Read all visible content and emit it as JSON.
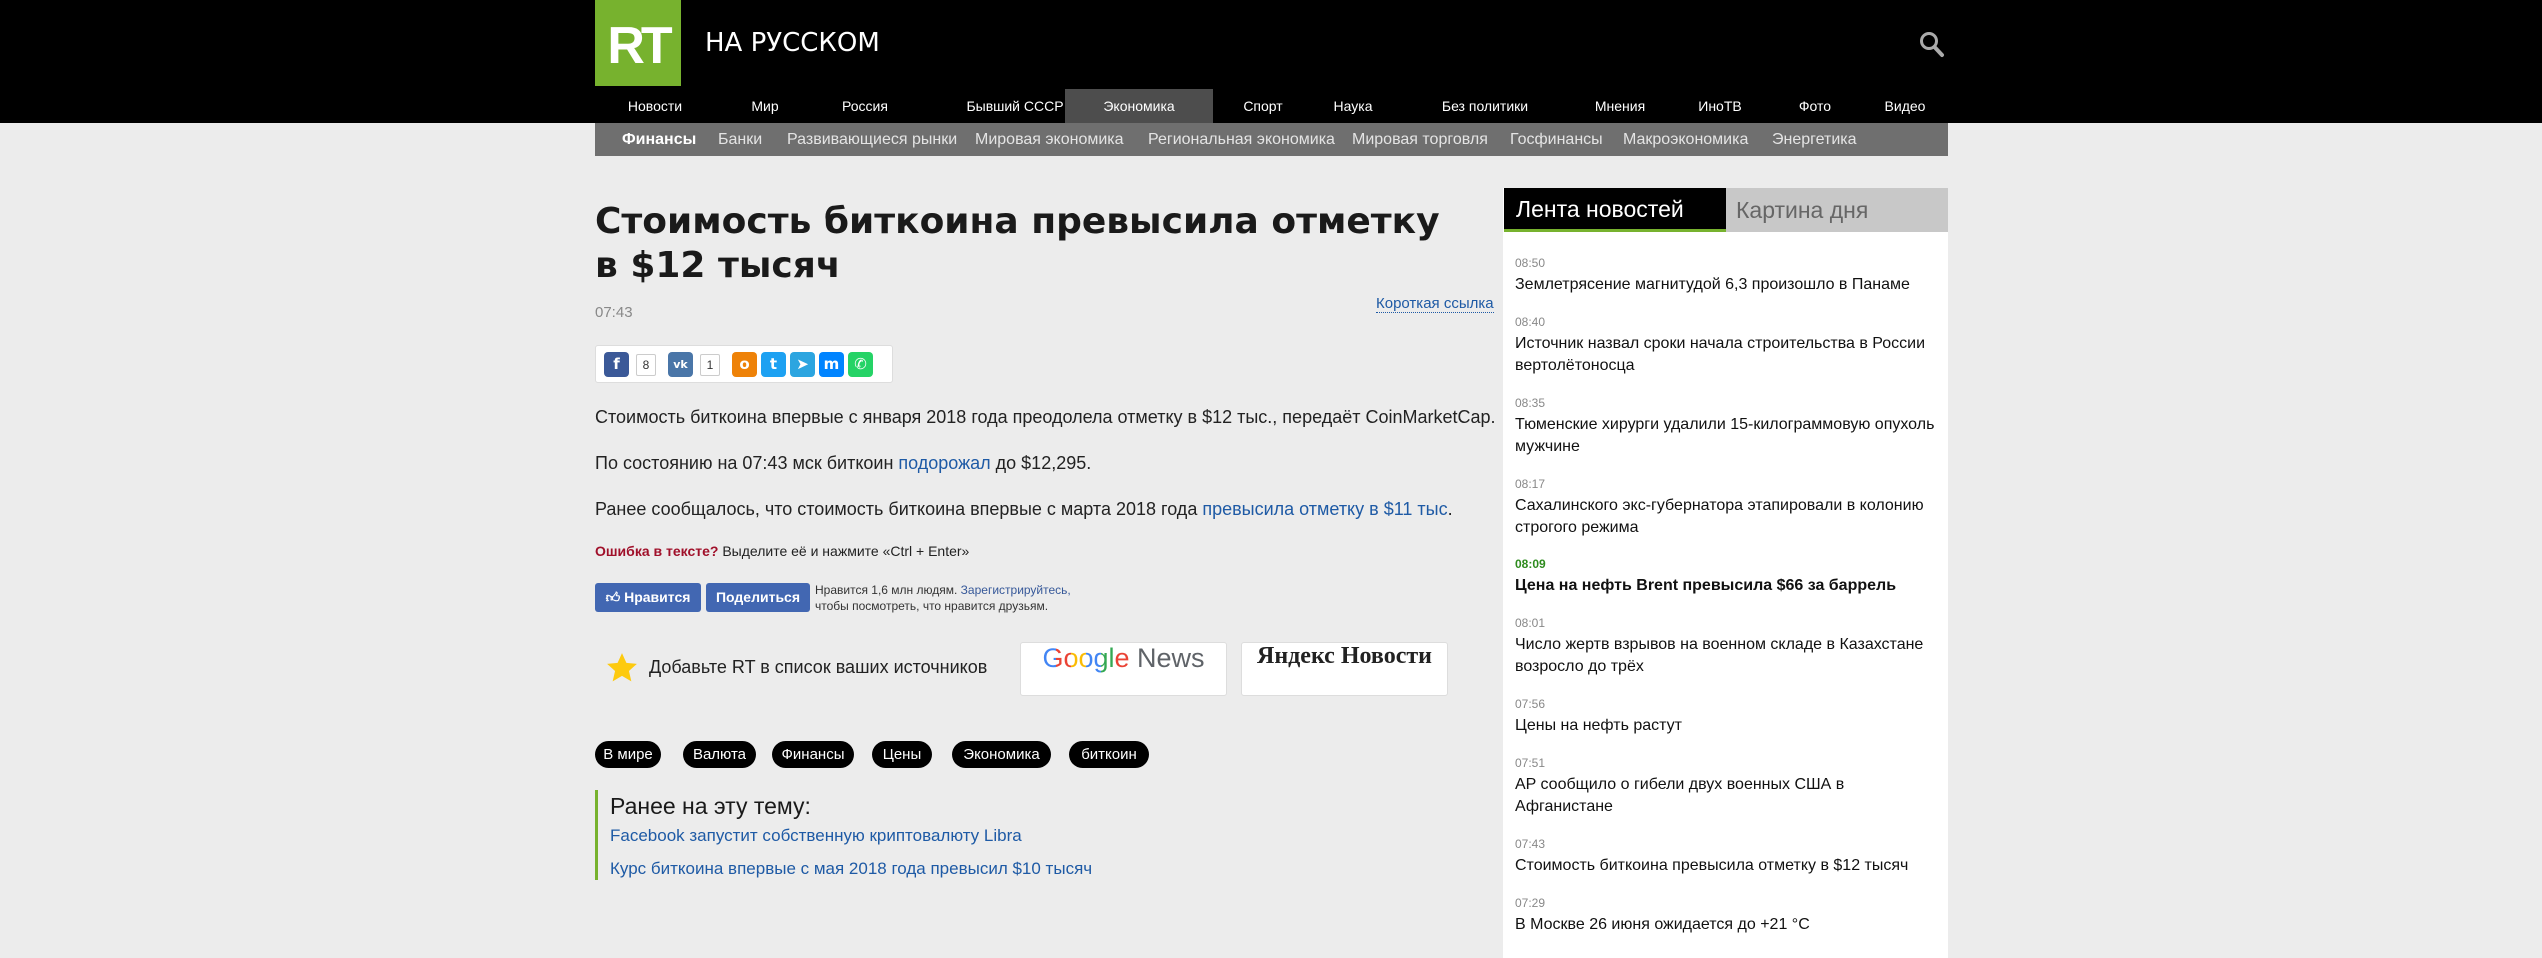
{
  "header": {
    "logo": "RT",
    "site_name": "НА РУССКОМ"
  },
  "nav": [
    "Новости",
    "Мир",
    "Россия",
    "Бывший СССР",
    "Экономика",
    "Спорт",
    "Наука",
    "Без политики",
    "Мнения",
    "ИноТВ",
    "Фото",
    "Видео"
  ],
  "subnav": [
    "Финансы",
    "Банки",
    "Развивающиеся рынки",
    "Мировая экономика",
    "Региональная экономика",
    "Мировая торговля",
    "Госфинансы",
    "Макроэкономика",
    "Энергетика"
  ],
  "article": {
    "title": "Стоимость биткоина превысила отметку в $12 тысяч",
    "time": "07:43",
    "short_link": "Короткая ссылка",
    "share": {
      "fb_count": "8",
      "vk_count": "1"
    },
    "p1": "Стоимость биткоина впервые с января 2018 года преодолела отметку в $12 тыс., передаёт CoinMarketCap.",
    "p2_before": "По состоянию на 07:43 мск биткоин ",
    "p2_link": "подорожал",
    "p2_after": " до $12,295.",
    "p3_before": "Ранее сообщалось, что стоимость биткоина впервые с марта 2018 года ",
    "p3_link": "превысила отметку в $11 тыс",
    "p3_after": ".",
    "error_label": "Ошибка в тексте?",
    "error_hint": " Выделите её и нажмите «Ctrl + Enter»"
  },
  "facebook": {
    "like": "Нравится",
    "share": "Поделиться",
    "line1": "Нравится 1,6 млн людям. ",
    "register": "Зарегистрируйтесь,",
    "line2": "чтобы посмотреть, что нравится друзьям."
  },
  "sources": {
    "add_text": "Добавьте RT в список ваших источников",
    "google_word": "Google",
    "news_word": "News",
    "yandex": "Яндекс Новости"
  },
  "tags": [
    "В мире",
    "Валюта",
    "Финансы",
    "Цены",
    "Экономика",
    "биткоин"
  ],
  "related": {
    "heading": "Ранее на эту тему:",
    "links": [
      "Facebook запустит собственную криптовалюту Libra",
      "Курс биткоина впервые с мая 2018 года превысил $10 тысяч"
    ]
  },
  "sidebar": {
    "tabs": [
      "Лента новостей",
      "Картина дня"
    ],
    "news": [
      {
        "time": "08:50",
        "title": "Землетрясение магнитудой 6,3 произошло в Панаме"
      },
      {
        "time": "08:40",
        "title": "Источник назвал сроки начала строительства в России вертолётоносца"
      },
      {
        "time": "08:35",
        "title": "Тюменские хирурги удалили 15-килограммовую опухоль мужчине"
      },
      {
        "time": "08:17",
        "title": "Сахалинского экс-губернатора этапировали в колонию строгого режима"
      },
      {
        "time": "08:09",
        "title": "Цена на нефть Brent превысила $66 за баррель"
      },
      {
        "time": "08:01",
        "title": "Число жертв взрывов на военном складе в Казахстане возросло до трёх"
      },
      {
        "time": "07:56",
        "title": "Цены на нефть растут"
      },
      {
        "time": "07:51",
        "title": "AP сообщило о гибели двух военных США в Афганистане"
      },
      {
        "time": "07:43",
        "title": "Стоимость биткоина превысила отметку в $12 тысяч"
      },
      {
        "time": "07:29",
        "title": "В Москве 26 июня ожидается до +21 °C"
      }
    ]
  },
  "colors": {
    "brand_green": "#77b22e",
    "link": "#1e5aa5",
    "nav_active": "#4d4d4d",
    "subnav": "#6f6f6f",
    "facebook": "#4267b2"
  }
}
